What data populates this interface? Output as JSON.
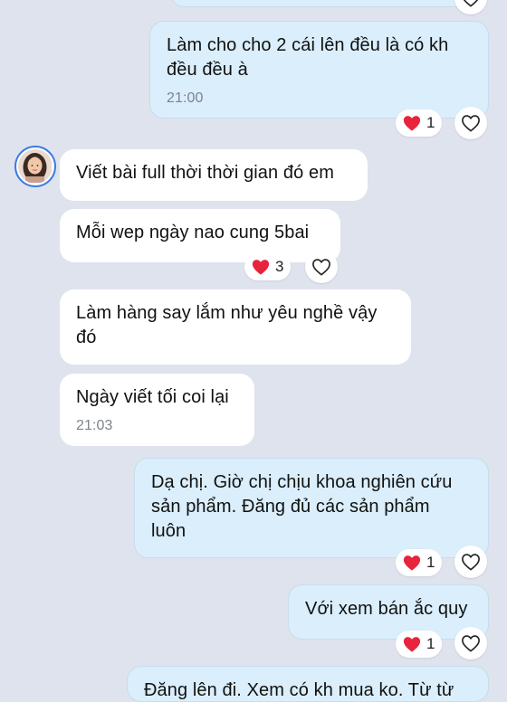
{
  "colors": {
    "background": "#dfe3ee",
    "incoming_bubble": "#ffffff",
    "outgoing_bubble": "#daeefb",
    "heart": "#e8233c",
    "timestamp": "#7d848c"
  },
  "icons": {
    "reaction": "heart-icon",
    "like_button": "heart-outline-icon"
  },
  "contact": {
    "avatar": "avatar"
  },
  "messages": [
    {
      "direction": "out",
      "text": "",
      "time": "",
      "reaction": null
    },
    {
      "direction": "out",
      "text": "Làm cho cho 2 cái lên đều là có kh\nđều đều à",
      "time": "21:00",
      "reaction": {
        "emoji": "heart",
        "count": "1"
      }
    },
    {
      "direction": "in",
      "text": "Viết bài full thời thời gian đó em",
      "time": "",
      "reaction": null
    },
    {
      "direction": "in",
      "text": "Mỗi wep ngày nao cung 5bai",
      "time": "",
      "reaction": {
        "emoji": "heart",
        "count": "3"
      }
    },
    {
      "direction": "in",
      "text": "Làm hàng say lắm như yêu nghề vậy\nđó",
      "time": "",
      "reaction": null
    },
    {
      "direction": "in",
      "text": "Ngày viết tối coi lại",
      "time": "21:03",
      "reaction": null
    },
    {
      "direction": "out",
      "text": "Dạ chị. Giờ chị chịu khoa nghiên cứu\nsản phẩm. Đăng đủ các sản phẩm\nluôn",
      "time": "",
      "reaction": {
        "emoji": "heart",
        "count": "1"
      }
    },
    {
      "direction": "out",
      "text": "Với xem bán ắc quy",
      "time": "",
      "reaction": {
        "emoji": "heart",
        "count": "1"
      }
    },
    {
      "direction": "out",
      "text": "Đăng lên đi. Xem có kh mua ko. Từ từ",
      "time": "",
      "reaction": null
    }
  ]
}
